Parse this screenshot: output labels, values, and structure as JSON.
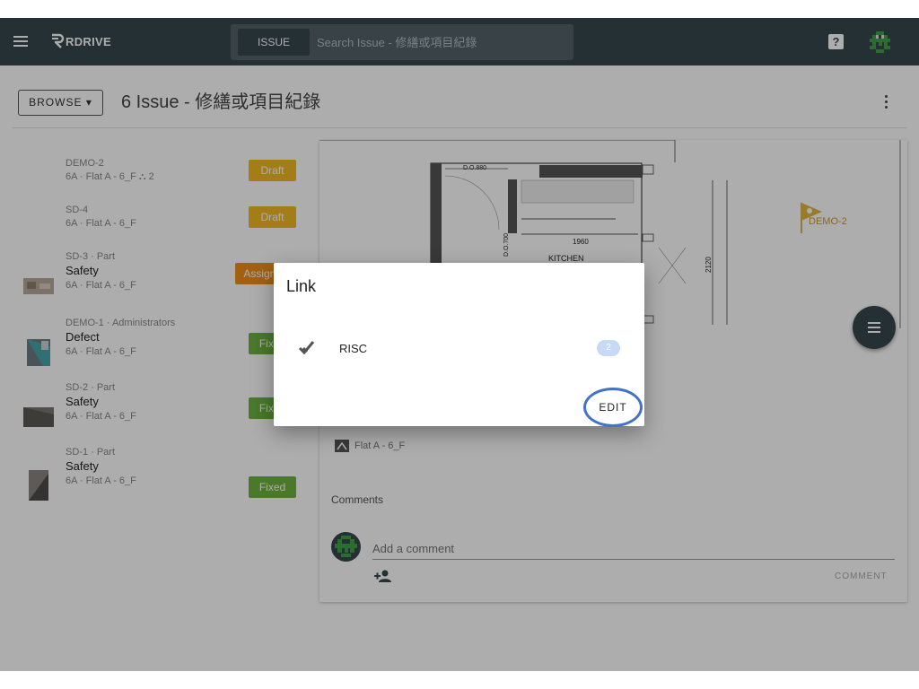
{
  "header": {
    "brand": "RDRIVE",
    "search_scope": "ISSUE",
    "search_placeholder": "Search Issue - 修繕或項目紀錄"
  },
  "toolbar": {
    "browse_label": "BROWSE ▾",
    "page_title": "6 Issue - 修繕或項目紀錄"
  },
  "issues": [
    {
      "meta": "DEMO-2",
      "title": "",
      "sub": "6A · Flat A - 6_F  ⛬ 2",
      "status": "Draft"
    },
    {
      "meta": "SD-4",
      "title": "",
      "sub": "6A · Flat A - 6_F",
      "status": "Draft"
    },
    {
      "meta": "SD-3 · Part",
      "title": "Safety",
      "sub": "6A · Flat A - 6_F",
      "status": "Assigned"
    },
    {
      "meta": "DEMO-1 · Administrators",
      "title": "Defect",
      "sub": "6A · Flat A - 6_F",
      "status": "Fixed"
    },
    {
      "meta": "SD-2 · Part",
      "title": "Safety",
      "sub": "6A · Flat A - 6_F",
      "status": "Fixed"
    },
    {
      "meta": "SD-1 · Part",
      "title": "Safety",
      "sub": "6A · Flat A - 6_F",
      "status": "Fixed"
    }
  ],
  "colors": {
    "header_bg": "#37474f",
    "draft": "#f2b824",
    "assigned": "#ef8f1a",
    "fixed": "#6db33f",
    "edit_highlight": "#4472c4"
  },
  "floorplan": {
    "door_label": "D.O.880",
    "door_label_2": "D.O.700",
    "dim_1": "1960",
    "room_label": "KITCHEN",
    "dim_2": "2120",
    "pin_label": "DEMO-2"
  },
  "detail": {
    "location": "Flat A - 6_F",
    "comments_label": "Comments",
    "comment_placeholder": "Add a comment",
    "comment_button": "COMMENT"
  },
  "dialog": {
    "title": "Link",
    "row_label": "RISC",
    "row_count": "2",
    "edit_label": "EDIT"
  }
}
